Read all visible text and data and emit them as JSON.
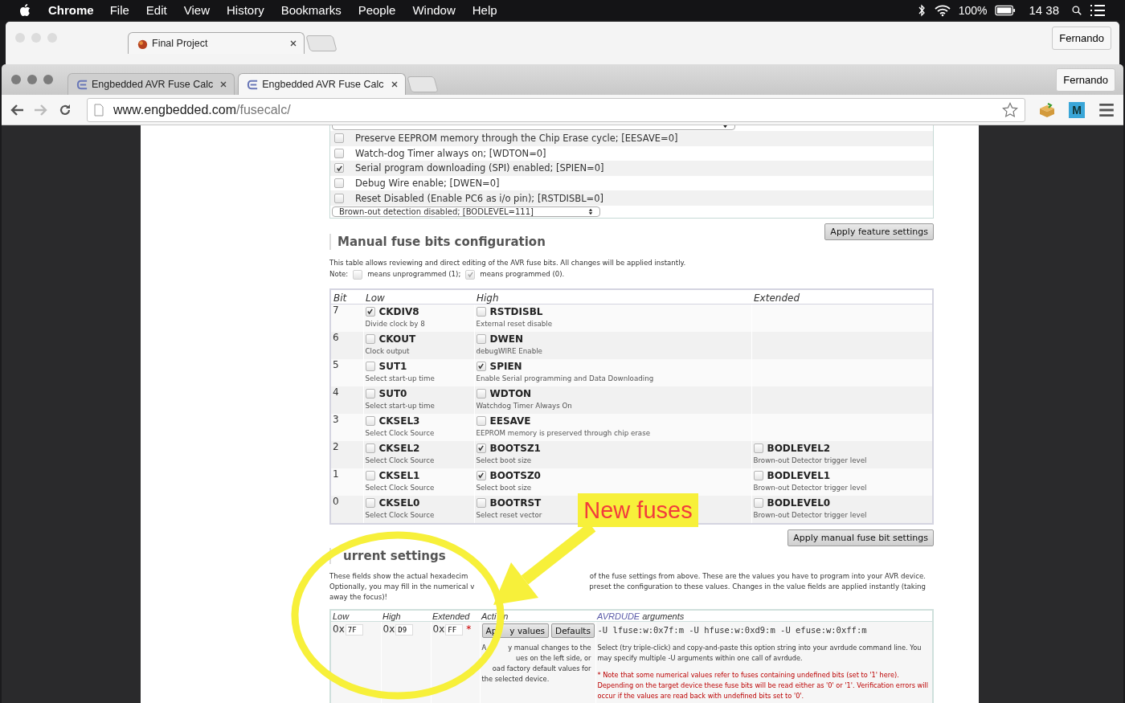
{
  "menubar": {
    "app": "Chrome",
    "menus": [
      "File",
      "Edit",
      "View",
      "History",
      "Bookmarks",
      "People",
      "Window",
      "Help"
    ],
    "battery": "100%",
    "time": "14 38"
  },
  "back_window": {
    "tab": "Final Project",
    "profile": "Fernando"
  },
  "window": {
    "tabs": [
      {
        "title": "Engbedded AVR Fuse Calc",
        "selected": false
      },
      {
        "title": "Engbedded AVR Fuse Calc",
        "selected": true
      }
    ],
    "profile": "Fernando",
    "address": {
      "domain": "www.engbedded.com",
      "path": "/fusecalc/"
    },
    "extension_label": "M"
  },
  "feature_settings": {
    "options": [
      {
        "label": "Preserve EEPROM memory through the Chip Erase cycle; [EESAVE=0]",
        "checked": false
      },
      {
        "label": "Watch-dog Timer always on; [WDTON=0]",
        "checked": false
      },
      {
        "label": "Serial program downloading (SPI) enabled; [SPIEN=0]",
        "checked": true
      },
      {
        "label": "Debug Wire enable; [DWEN=0]",
        "checked": false
      },
      {
        "label": "Reset Disabled (Enable PC6 as i/o pin); [RSTDISBL=0]",
        "checked": false
      }
    ],
    "bod_select": "Brown-out detection disabled; [BODLEVEL=111]",
    "apply_button": "Apply feature settings"
  },
  "manual": {
    "heading": "Manual fuse bits configuration",
    "description": "This table allows reviewing and direct editing of the AVR fuse bits. All changes will be applied instantly.",
    "note": {
      "label": "Note:",
      "legend": [
        {
          "checked": false,
          "text": "means unprogrammed (1);"
        },
        {
          "checked": true,
          "text": "means programmed (0)."
        }
      ]
    },
    "columns": [
      "Bit",
      "Low",
      "High",
      "Extended"
    ],
    "rows": [
      {
        "bit": "7",
        "low": {
          "name": "CKDIV8",
          "desc": "Divide clock by 8",
          "checked": true
        },
        "high": {
          "name": "RSTDISBL",
          "desc": "External reset disable",
          "checked": false
        }
      },
      {
        "bit": "6",
        "low": {
          "name": "CKOUT",
          "desc": "Clock output",
          "checked": false
        },
        "high": {
          "name": "DWEN",
          "desc": "debugWIRE Enable",
          "checked": false
        }
      },
      {
        "bit": "5",
        "low": {
          "name": "SUT1",
          "desc": "Select start-up time",
          "checked": false
        },
        "high": {
          "name": "SPIEN",
          "desc": "Enable Serial programming and Data Downloading",
          "checked": true
        }
      },
      {
        "bit": "4",
        "low": {
          "name": "SUT0",
          "desc": "Select start-up time",
          "checked": false
        },
        "high": {
          "name": "WDTON",
          "desc": "Watchdog Timer Always On",
          "checked": false
        }
      },
      {
        "bit": "3",
        "low": {
          "name": "CKSEL3",
          "desc": "Select Clock Source",
          "checked": false
        },
        "high": {
          "name": "EESAVE",
          "desc": "EEPROM memory is preserved through chip erase",
          "checked": false
        }
      },
      {
        "bit": "2",
        "low": {
          "name": "CKSEL2",
          "desc": "Select Clock Source",
          "checked": false
        },
        "high": {
          "name": "BOOTSZ1",
          "desc": "Select boot size",
          "checked": true
        },
        "extended": {
          "name": "BODLEVEL2",
          "desc": "Brown-out Detector trigger level",
          "checked": false
        }
      },
      {
        "bit": "1",
        "low": {
          "name": "CKSEL1",
          "desc": "Select Clock Source",
          "checked": false
        },
        "high": {
          "name": "BOOTSZ0",
          "desc": "Select boot size",
          "checked": true
        },
        "extended": {
          "name": "BODLEVEL1",
          "desc": "Brown-out Detector trigger level",
          "checked": false
        }
      },
      {
        "bit": "0",
        "low": {
          "name": "CKSEL0",
          "desc": "Select Clock Source",
          "checked": false
        },
        "high": {
          "name": "BOOTRST",
          "desc": "Select reset vector",
          "checked": false
        },
        "extended": {
          "name": "BODLEVEL0",
          "desc": "Brown-out Detector trigger level",
          "checked": false
        }
      }
    ],
    "apply_button": "Apply manual fuse bit settings"
  },
  "current": {
    "heading": "urrent settings",
    "paragraph_lines": [
      [
        "These fields show the actual hexadecim",
        "of the fuse settings from above. These are the values you have to program into your AVR device."
      ],
      [
        "Optionally, you may fill in the numerical v",
        "preset the configuration to these values. Changes in the value fields are applied instantly (taking"
      ],
      [
        "away the focus)!"
      ]
    ],
    "columns": [
      "Low",
      "High",
      "Extended"
    ],
    "action_header": [
      "Acti",
      "n"
    ],
    "args_header": {
      "highlight": "AVRDUDE",
      "rest": "arguments"
    },
    "values": [
      {
        "prefix": "0x",
        "value": "7F"
      },
      {
        "prefix": "0x",
        "value": "D9"
      },
      {
        "prefix": "0x",
        "value": "FF",
        "mark": "*"
      }
    ],
    "buttons": [
      {
        "parts": [
          "Ap",
          "y values"
        ]
      },
      {
        "parts": [
          "Defaults"
        ]
      }
    ],
    "action_note_lines": [
      [
        "A",
        "y manual changes to the"
      ],
      [
        "ues on the left side, or"
      ],
      [
        "oad factory default values for"
      ],
      [
        "the selected device."
      ]
    ],
    "avrdude_args": "-U lfuse:w:0x7f:m -U hfuse:w:0xd9:m -U efuse:w:0xff:m",
    "args_help": "Select (try triple-click) and copy-and-paste this option string into your avrdude command line. You may specify multiple -U arguments within one call of avrdude.",
    "warning": "* Note that some numerical values refer to fuses containing undefined bits (set to '1' here). Depending on the target device these fuse bits will be read either as '0' or '1'. Verification errors will occur if the values are read back with undefined bits set to '0'."
  },
  "annotation": {
    "label": "New fuses"
  }
}
